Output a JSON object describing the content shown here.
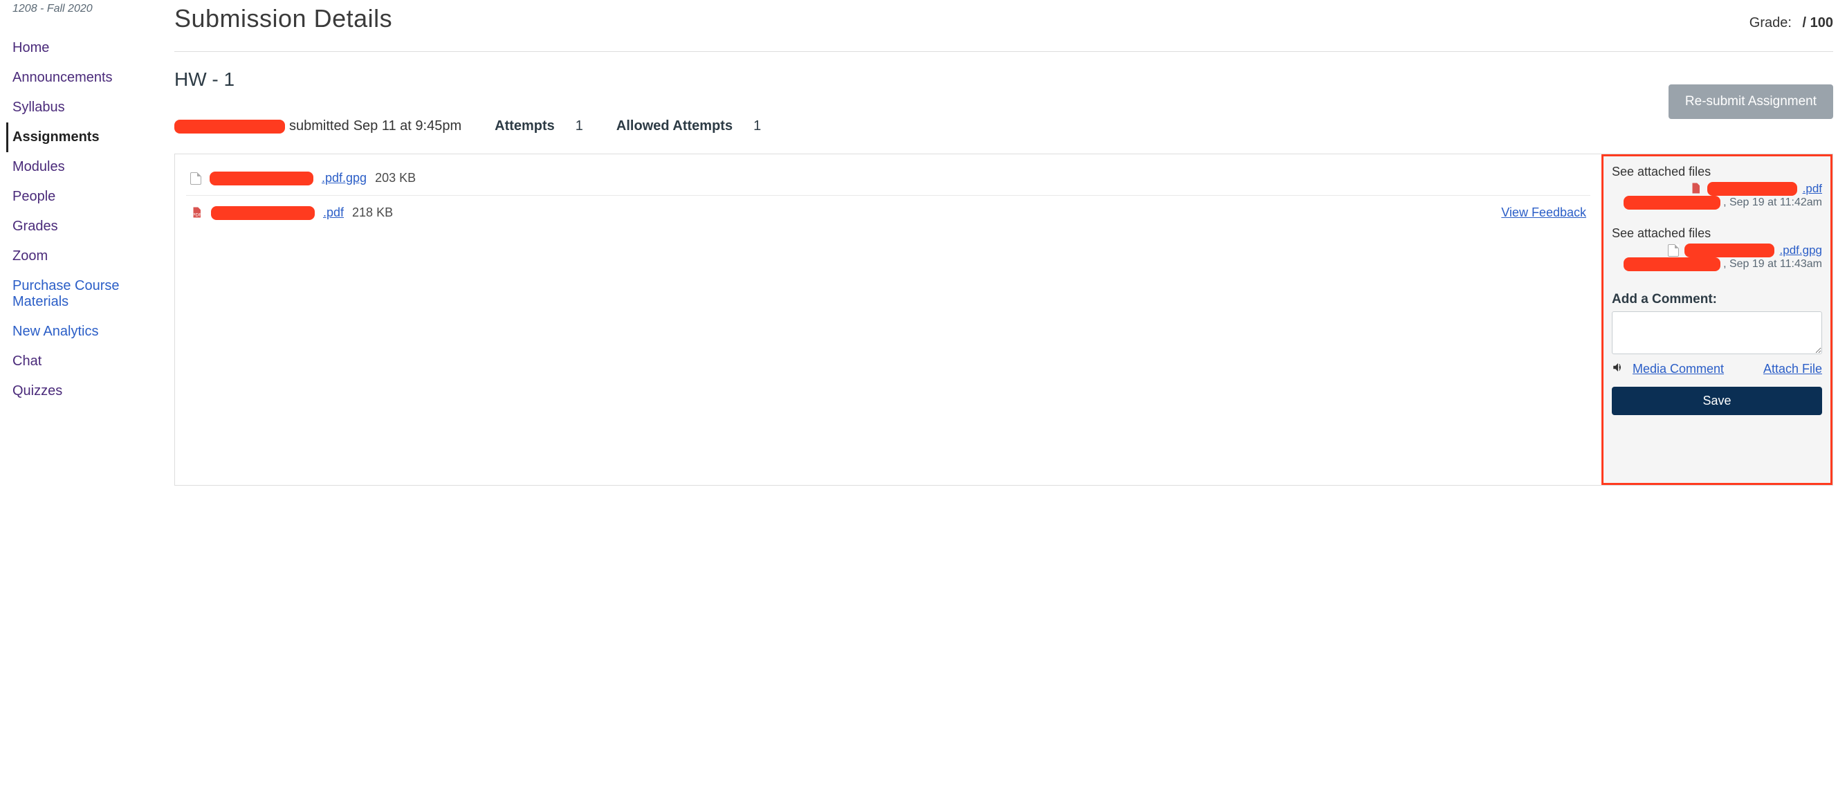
{
  "course": {
    "code": "1208 - Fall 2020"
  },
  "nav": {
    "items": [
      {
        "label": "Home",
        "key": "home"
      },
      {
        "label": "Announcements",
        "key": "announcements"
      },
      {
        "label": "Syllabus",
        "key": "syllabus"
      },
      {
        "label": "Assignments",
        "key": "assignments",
        "active": true
      },
      {
        "label": "Modules",
        "key": "modules"
      },
      {
        "label": "People",
        "key": "people"
      },
      {
        "label": "Grades",
        "key": "grades"
      },
      {
        "label": "Zoom",
        "key": "zoom"
      },
      {
        "label": "Purchase Course Materials",
        "key": "materials",
        "alt": true
      },
      {
        "label": "New Analytics",
        "key": "analytics",
        "alt": true
      },
      {
        "label": "Chat",
        "key": "chat"
      },
      {
        "label": "Quizzes",
        "key": "quizzes"
      }
    ]
  },
  "header": {
    "title": "Submission Details",
    "grade_label": "Grade:",
    "grade_value": "",
    "grade_out_of": "/ 100"
  },
  "assignment": {
    "name": "HW - 1",
    "submitted_prefix": "submitted",
    "submitted_at": "Sep 11 at 9:45pm",
    "attempts_label": "Attempts",
    "attempts_value": "1",
    "allowed_label": "Allowed Attempts",
    "allowed_value": "1",
    "resubmit_label": "Re-submit Assignment"
  },
  "files": [
    {
      "ext": ".pdf.gpg",
      "size": "203 KB",
      "icon": "unknown",
      "feedback": false
    },
    {
      "ext": ".pdf",
      "size": "218 KB",
      "icon": "pdf",
      "feedback": true,
      "feedback_label": "View Feedback"
    }
  ],
  "comments": {
    "items": [
      {
        "title": "See attached files",
        "attachment_ext": ".pdf",
        "attachment_icon": "pdf",
        "meta_time": ", Sep 19 at 11:42am"
      },
      {
        "title": "See attached files",
        "attachment_ext": ".pdf.gpg",
        "attachment_icon": "unknown",
        "meta_time": ", Sep 19 at 11:43am"
      }
    ],
    "add_label": "Add a Comment:",
    "media_label": "Media Comment",
    "attach_label": "Attach File",
    "save_label": "Save",
    "placeholder": ""
  }
}
